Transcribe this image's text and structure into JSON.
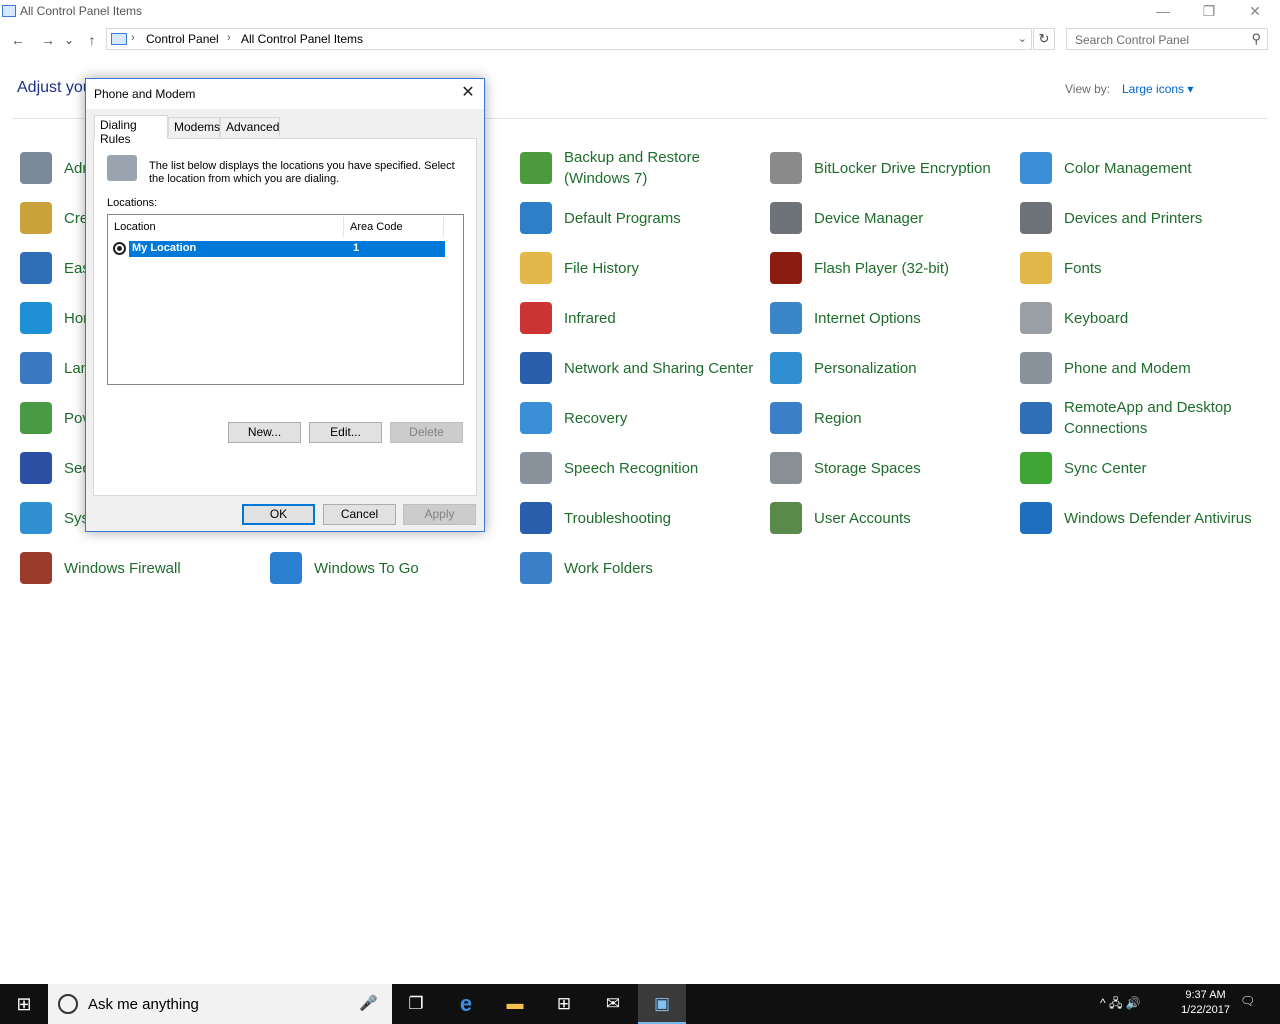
{
  "window": {
    "title": "All Control Panel Items",
    "minimize": "—",
    "restore": "❐",
    "close": "✕"
  },
  "nav": {
    "back": "←",
    "forward": "→",
    "recent": "⌄",
    "up": "↑"
  },
  "address": {
    "crumbs": [
      "Control Panel",
      "All Control Panel Items"
    ],
    "sep": "›",
    "dropdown": "⌄",
    "refresh": "↻"
  },
  "search": {
    "placeholder": "Search Control Panel",
    "icon": "⚲"
  },
  "header": {
    "adjust": "Adjust you",
    "view_by_label": "View by:",
    "view_by_value": "Large icons ▾"
  },
  "items": [
    {
      "label": "Adr",
      "color": "#7a8a99"
    },
    {
      "label": "Cre",
      "color": "#c9a23a"
    },
    {
      "label": "Eas",
      "color": "#2e6fb8"
    },
    {
      "label": "Hor",
      "color": "#1f8fd6"
    },
    {
      "label": "Lan",
      "color": "#3b78c2"
    },
    {
      "label": "Pov",
      "color": "#4a9a45"
    },
    {
      "label": "Sec",
      "color": "#2a4fa3"
    },
    {
      "label": "Sys",
      "color": "#2f8fd0"
    },
    {
      "label": "Windows Firewall",
      "color": "#9a3b2a"
    },
    {
      "label": "Windows To Go",
      "color": "#2a7fd0"
    },
    {
      "label": "Backup and Restore (Windows 7)",
      "color": "#4b9a3c"
    },
    {
      "label": "Default Programs",
      "color": "#2d7fc8"
    },
    {
      "label": "File History",
      "color": "#e2b84a"
    },
    {
      "label": "Infrared",
      "color": "#c33"
    },
    {
      "label": "Network and Sharing Center",
      "color": "#2a5fae"
    },
    {
      "label": "Recovery",
      "color": "#3a8fd6"
    },
    {
      "label": "Speech Recognition",
      "color": "#8a939c"
    },
    {
      "label": "Troubleshooting",
      "color": "#2a5fae"
    },
    {
      "label": "Work Folders",
      "color": "#3a7fc8"
    },
    {
      "label": "BitLocker Drive Encryption",
      "color": "#8a8a8a"
    },
    {
      "label": "Device Manager",
      "color": "#6d7378"
    },
    {
      "label": "Flash Player (32-bit)",
      "color": "#8b1c12"
    },
    {
      "label": "Internet Options",
      "color": "#3a86c8"
    },
    {
      "label": "Personalization",
      "color": "#2f8fd0"
    },
    {
      "label": "Region",
      "color": "#3a7fc8"
    },
    {
      "label": "Storage Spaces",
      "color": "#8a8f94"
    },
    {
      "label": "User Accounts",
      "color": "#5a8a4a"
    },
    {
      "label": "Color Management",
      "color": "#3a8fd6"
    },
    {
      "label": "Devices and Printers",
      "color": "#6d7378"
    },
    {
      "label": "Fonts",
      "color": "#e2b84a"
    },
    {
      "label": "Keyboard",
      "color": "#9aa0a6"
    },
    {
      "label": "Phone and Modem",
      "color": "#8a939c"
    },
    {
      "label": "RemoteApp and Desktop Connections",
      "color": "#2f6fb8"
    },
    {
      "label": "Sync Center",
      "color": "#3fa535"
    },
    {
      "label": "Windows Defender Antivirus",
      "color": "#1f6fc0"
    }
  ],
  "dialog": {
    "title": "Phone and Modem",
    "close": "✕",
    "tabs": [
      "Dialing Rules",
      "Modems",
      "Advanced"
    ],
    "description": "The list below displays the locations you have specified. Select the location from which you are dialing.",
    "locations_label": "Locations:",
    "columns": [
      "Location",
      "Area Code"
    ],
    "rows": [
      {
        "location": "My Location",
        "area_code": "1"
      }
    ],
    "buttons": {
      "new": "New...",
      "edit": "Edit...",
      "delete": "Delete",
      "ok": "OK",
      "cancel": "Cancel",
      "apply": "Apply"
    }
  },
  "taskbar": {
    "start": "⊞",
    "cortana": "Ask me anything",
    "mic": "🎤",
    "icons": [
      "task-view",
      "edge",
      "file-explorer",
      "store",
      "mail",
      "control-panel"
    ],
    "icon_glyphs": [
      "❐",
      "e",
      "▬",
      "⊞",
      "✉",
      "▣"
    ],
    "tray": "^  🖧  🔊",
    "time": "9:37 AM",
    "date": "1/22/2017",
    "notifications": "🗨"
  }
}
